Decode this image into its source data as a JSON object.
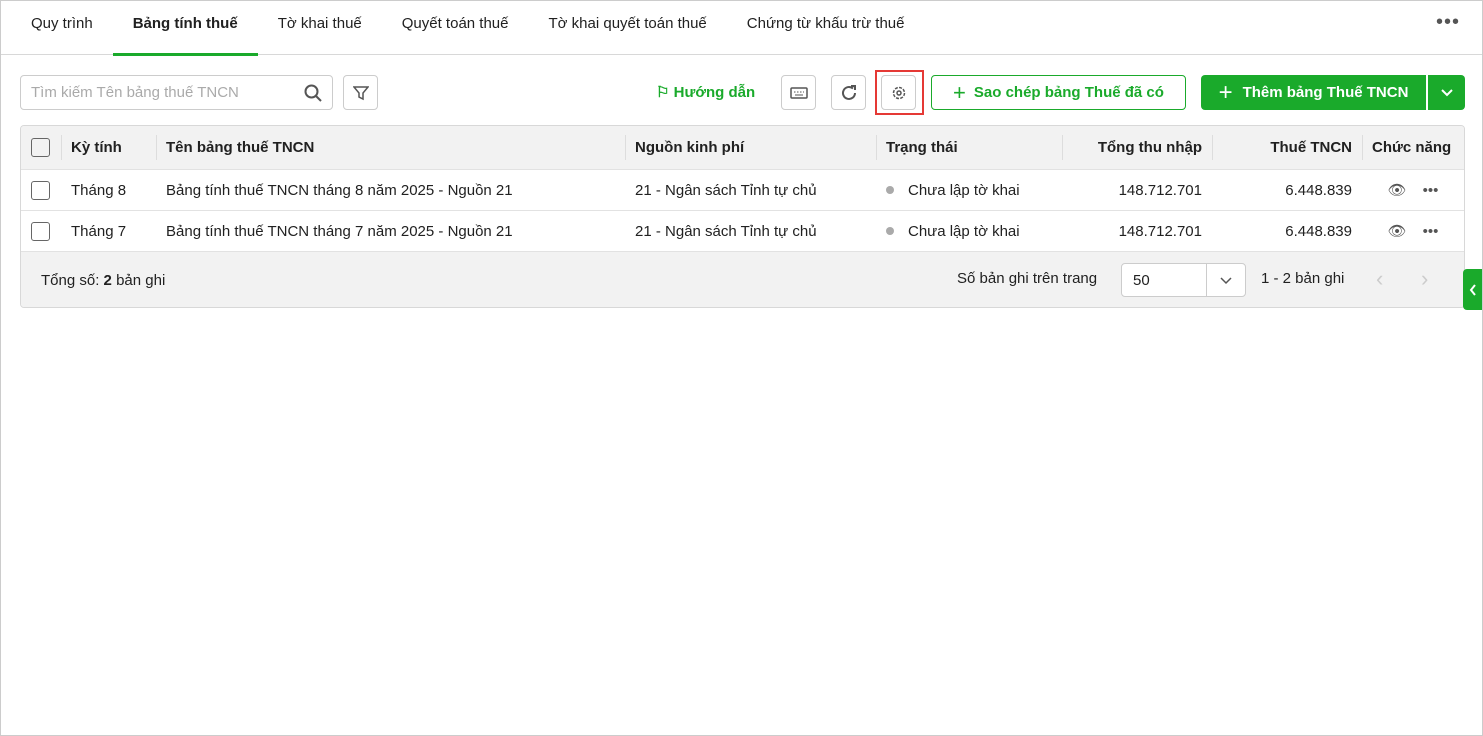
{
  "tabs": [
    "Quy trình",
    "Bảng tính thuế",
    "Tờ khai thuế",
    "Quyết toán thuế",
    "Tờ khai quyết toán thuế",
    "Chứng từ khấu trừ thuế"
  ],
  "more": "•••",
  "toolbar": {
    "search_placeholder": "Tìm kiếm Tên bảng thuế TNCN",
    "guide": "Hướng dẫn",
    "copy": "Sao chép bảng Thuế đã có",
    "add": "Thêm bảng Thuế TNCN"
  },
  "columns": [
    "Kỳ tính",
    "Tên bảng thuế TNCN",
    "Nguồn kinh phí",
    "Trạng thái",
    "Tổng thu nhập",
    "Thuế TNCN",
    "Chức năng"
  ],
  "rows": [
    {
      "period": "Tháng 8",
      "name": "Bảng tính thuế TNCN tháng 8 năm 2025 - Nguồn 21",
      "source": "21 - Ngân sách Tỉnh tự chủ",
      "status": "Chưa lập tờ khai",
      "income": "148.712.701",
      "tax": "6.448.839"
    },
    {
      "period": "Tháng 7",
      "name": "Bảng tính thuế TNCN tháng 7 năm 2025 - Nguồn 21",
      "source": "21 - Ngân sách Tỉnh tự chủ",
      "status": "Chưa lập tờ khai",
      "income": "148.712.701",
      "tax": "6.448.839"
    }
  ],
  "footer": {
    "total_label": "Tổng số:",
    "total_count": "2",
    "total_suffix": "bản ghi",
    "per_page_label": "Số bản ghi trên trang",
    "per_page": "50",
    "range": "1 - 2 bản ghi"
  },
  "colors": {
    "accent": "#1aaa2b",
    "highlight": "#e53935"
  }
}
